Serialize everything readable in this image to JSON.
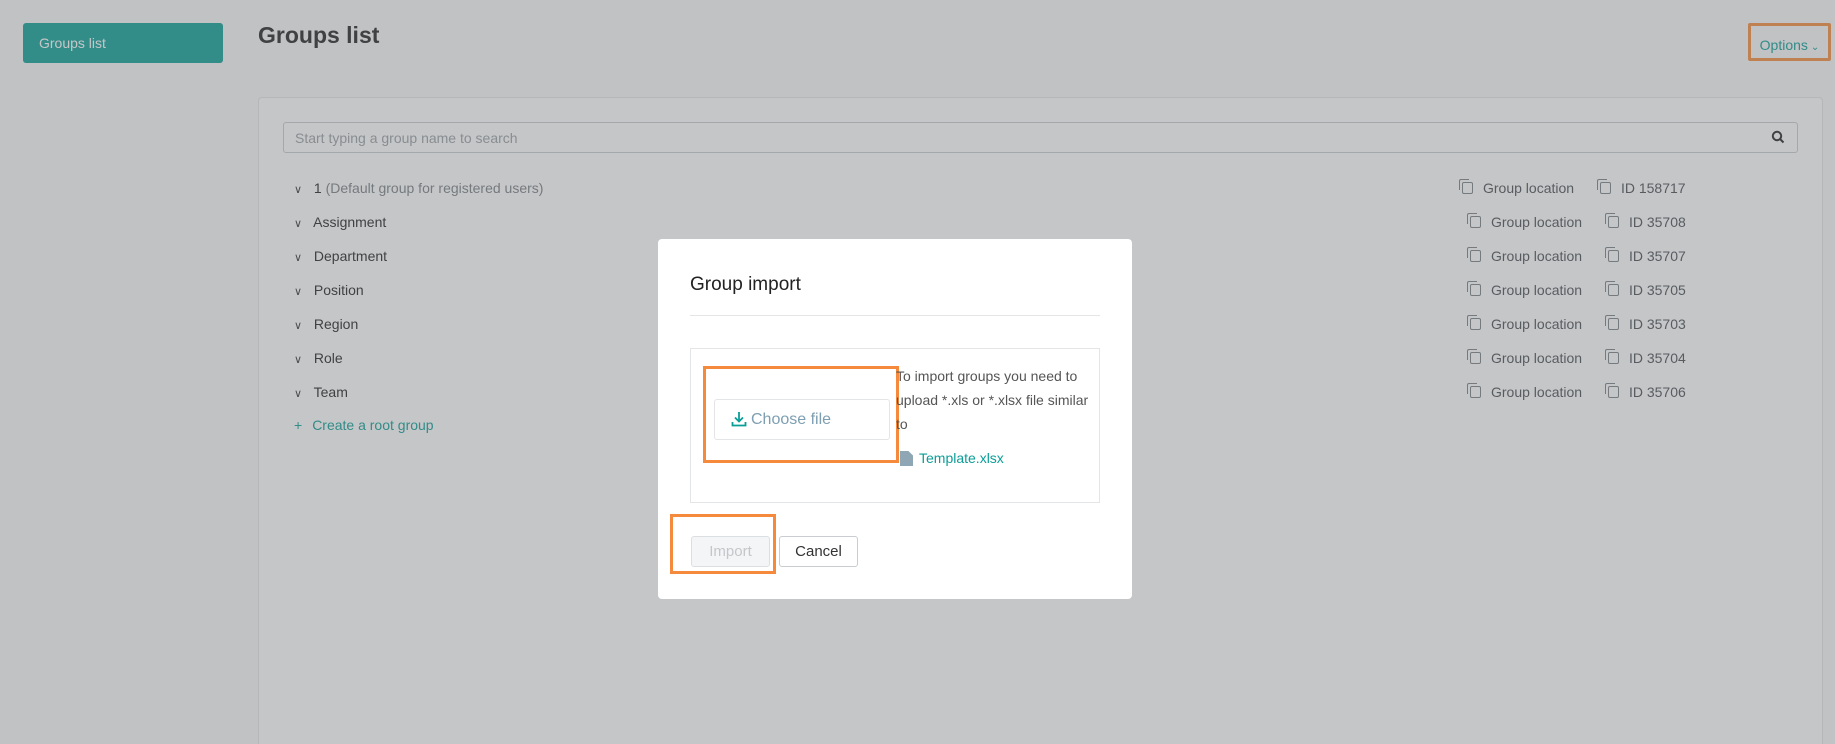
{
  "sidebar": {
    "active_item": "Groups list"
  },
  "page": {
    "title": "Groups list",
    "options_label": "Options"
  },
  "search": {
    "placeholder": "Start typing a group name to search",
    "value": ""
  },
  "groups": [
    {
      "name": "1",
      "note": "(Default group for registered users)",
      "location_label": "Group location",
      "id_label": "ID 158717"
    },
    {
      "name": "Assignment",
      "location_label": "Group location",
      "id_label": "ID 35708"
    },
    {
      "name": "Department",
      "location_label": "Group location",
      "id_label": "ID 35707"
    },
    {
      "name": "Position",
      "location_label": "Group location",
      "id_label": "ID 35705"
    },
    {
      "name": "Region",
      "location_label": "Group location",
      "id_label": "ID 35703"
    },
    {
      "name": "Role",
      "location_label": "Group location",
      "id_label": "ID 35704"
    },
    {
      "name": "Team",
      "location_label": "Group location",
      "id_label": "ID 35706"
    }
  ],
  "create_root_label": "Create a root group",
  "modal": {
    "title": "Group import",
    "choose_file_label": "Choose file",
    "hint_text": "To import groups you need to upload *.xls or *.xlsx file similar to",
    "template_link": "Template.xlsx",
    "import_label": "Import",
    "cancel_label": "Cancel"
  },
  "colors": {
    "accent": "#0a9e97",
    "highlight": "#f58a3c"
  }
}
